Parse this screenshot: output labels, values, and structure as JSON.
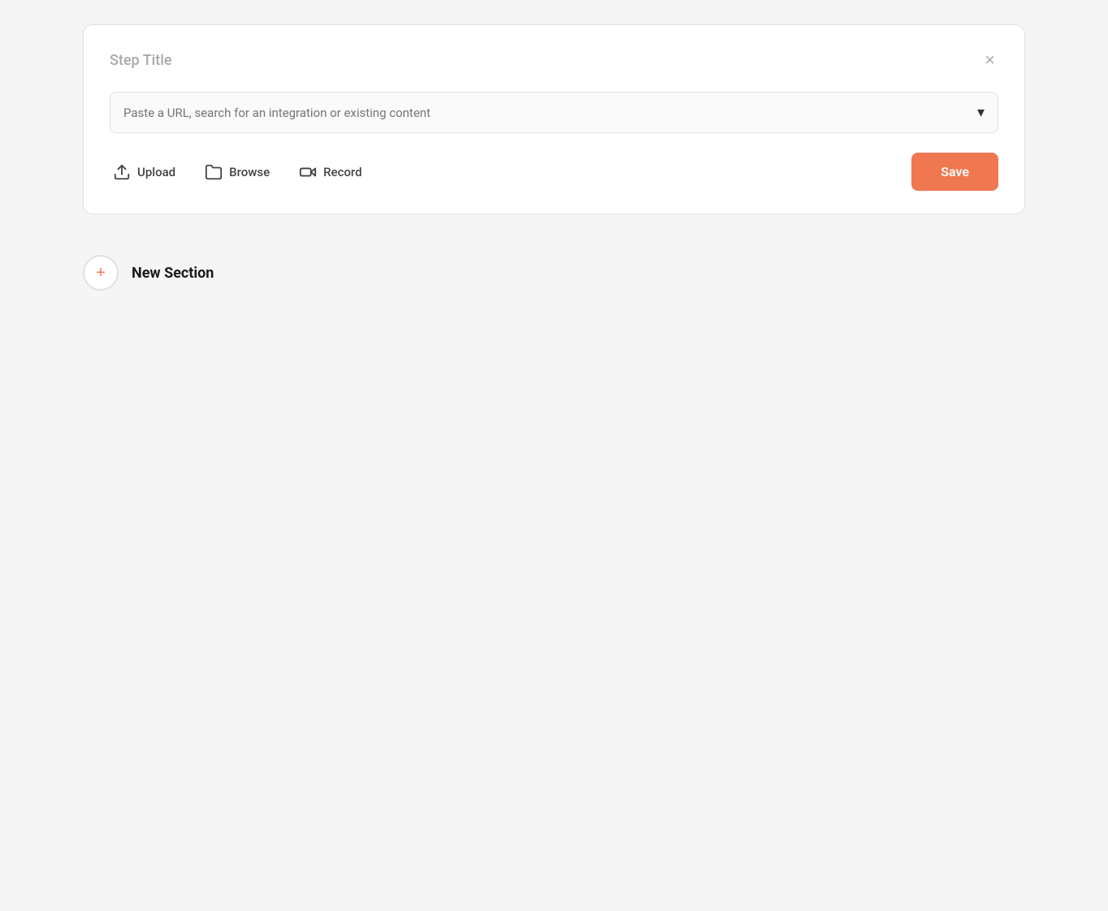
{
  "card": {
    "step_title": "Step Title",
    "close_label": "×",
    "search_placeholder": "Paste a URL, search for an integration or existing content",
    "chevron": "▾",
    "actions": {
      "upload_label": "Upload",
      "browse_label": "Browse",
      "record_label": "Record",
      "save_label": "Save"
    }
  },
  "new_section": {
    "label": "New Section",
    "plus_symbol": "+"
  },
  "colors": {
    "accent": "#f07850"
  }
}
